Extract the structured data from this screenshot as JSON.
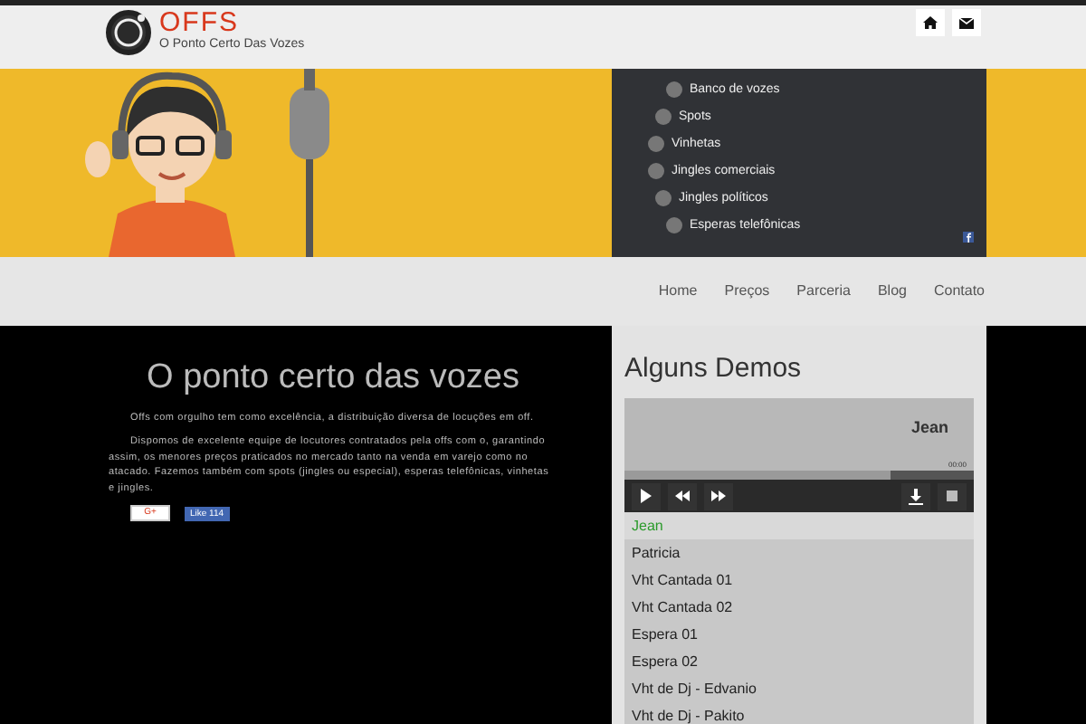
{
  "header": {
    "logo_text": "OFFS",
    "tagline": "O Ponto Certo Das Vozes"
  },
  "banner_menu": [
    "Banco de vozes",
    "Spots",
    "Vinhetas",
    "Jingles comerciais",
    "Jingles políticos",
    "Esperas telefônicas"
  ],
  "nav": [
    {
      "label": "Home",
      "selected": false
    },
    {
      "label": "Preços",
      "selected": false
    },
    {
      "label": "Parceria",
      "selected": false
    },
    {
      "label": "Blog",
      "selected": false
    },
    {
      "label": "Contato",
      "selected": false
    }
  ],
  "intro": {
    "heading": "O ponto certo das vozes",
    "paragraphs": [
      "Offs com orgulho tem como excelência, a distribuição diversa de locuções em off.",
      "Dispomos de excelente equipe de locutores contratados pela offs com o, garantindo assim, os menores preços praticados no mercado tanto na venda em varejo como no atacado. Fazemos também com spots (jingles ou especial), esperas telefônicas, vinhetas e jingles."
    ],
    "gplus": "G+",
    "like": "Like",
    "like_count": "114"
  },
  "demos": {
    "title": "Alguns Demos",
    "player": {
      "track": "Jean",
      "time": "00:00",
      "level": 0.76
    },
    "playlist": [
      {
        "label": "Jean",
        "selected": true
      },
      {
        "label": "Patricia",
        "selected": false
      },
      {
        "label": "Vht Cantada 01",
        "selected": false
      },
      {
        "label": "Vht Cantada 02",
        "selected": false
      },
      {
        "label": "Espera 01",
        "selected": false
      },
      {
        "label": "Espera 02",
        "selected": false
      },
      {
        "label": "Vht de Dj - Edvanio",
        "selected": false
      },
      {
        "label": "Vht de Dj - Pakito",
        "selected": false
      }
    ]
  }
}
